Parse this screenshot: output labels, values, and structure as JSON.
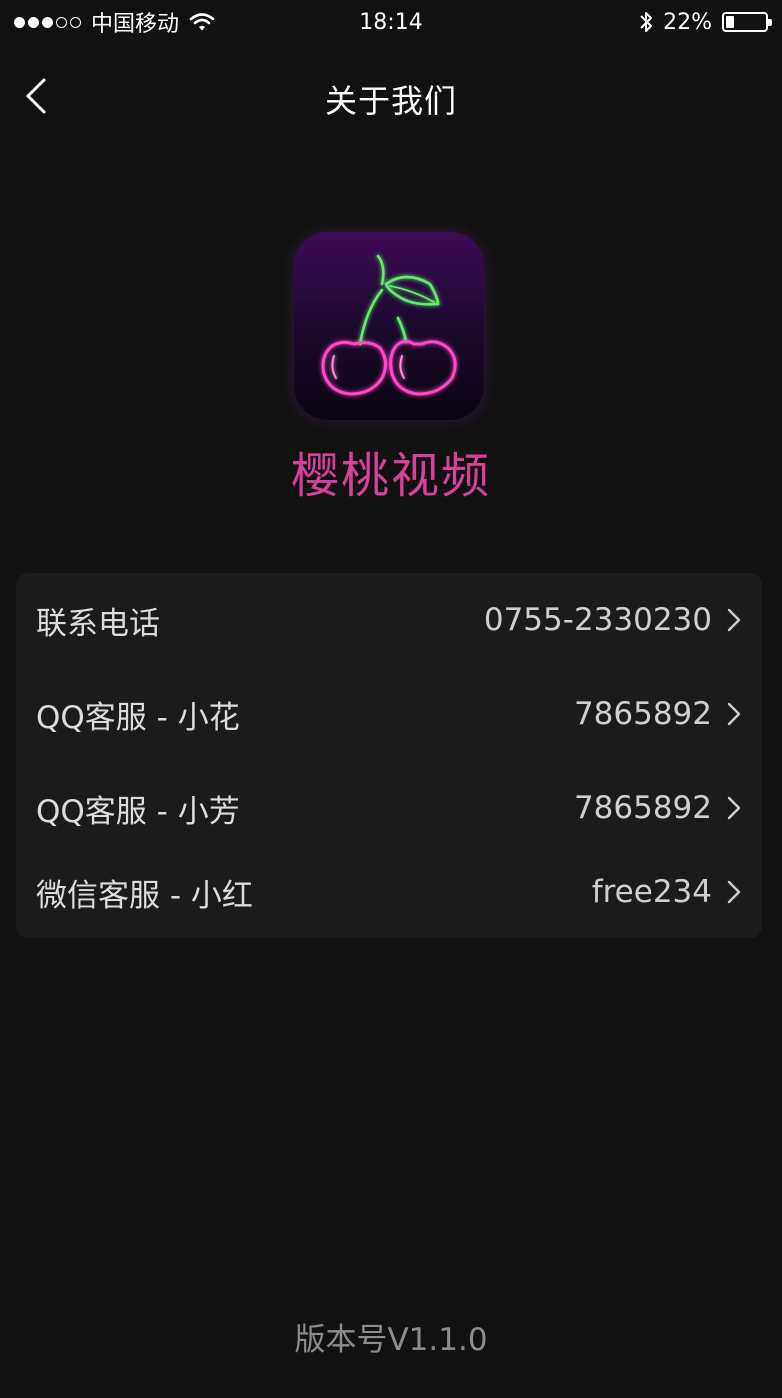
{
  "status_bar": {
    "carrier": "中国移动",
    "time": "18:14",
    "battery_text": "22%",
    "battery_level": 0.22,
    "signal_bars_filled": 3,
    "signal_bars_total": 5
  },
  "nav": {
    "title": "关于我们",
    "back_icon": "chevron-left-icon"
  },
  "app": {
    "name": "樱桃视频",
    "logo_icon": "cherry-neon-icon"
  },
  "contacts": [
    {
      "label": "联系电话",
      "value": "0755-2330230"
    },
    {
      "label": "QQ客服 - 小花",
      "value": "7865892"
    },
    {
      "label": "QQ客服 - 小芳",
      "value": "7865892"
    },
    {
      "label": "微信客服 - 小红",
      "value": "free234"
    }
  ],
  "version": "版本号V1.1.0",
  "colors": {
    "background": "#111111",
    "card": "#1b1b1b",
    "brand_pink": "#d8409a",
    "neon_green": "#5ef06a",
    "neon_pink": "#ff46c8"
  }
}
